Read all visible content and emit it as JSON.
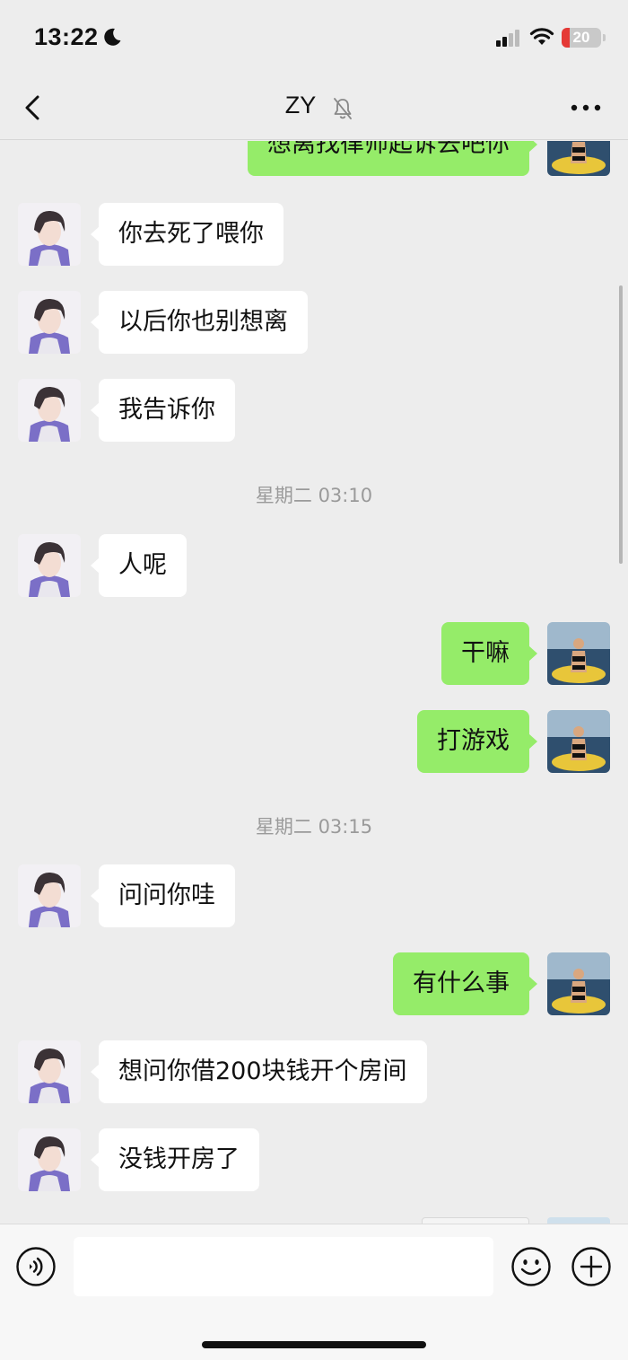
{
  "status_bar": {
    "time": "13:22",
    "battery_level": "20",
    "battery_fraction": 0.2,
    "icons": [
      "moon-icon",
      "signal-icon",
      "wifi-icon",
      "battery-icon"
    ]
  },
  "nav": {
    "title": "ZY",
    "icons": [
      "back-icon",
      "mute-bell-icon",
      "more-icon"
    ]
  },
  "messages": [
    {
      "side": "out",
      "text": "想离找律师起诉去吧你"
    },
    {
      "side": "in",
      "text": "你去死了喂你"
    },
    {
      "side": "in",
      "text": "以后你也别想离"
    },
    {
      "side": "in",
      "text": "我告诉你"
    },
    {
      "type": "time",
      "text": "星期二 03:10"
    },
    {
      "side": "in",
      "text": "人呢"
    },
    {
      "side": "out",
      "text": "干嘛"
    },
    {
      "side": "out",
      "text": "打游戏"
    },
    {
      "type": "time",
      "text": "星期二 03:15"
    },
    {
      "side": "in",
      "text": "问问你哇"
    },
    {
      "side": "out",
      "text": "有什么事"
    },
    {
      "side": "in",
      "text": "想问你借200块钱开个房间"
    },
    {
      "side": "in",
      "text": "没钱开房了"
    }
  ],
  "input_bar": {
    "placeholder": "",
    "icons": [
      "voice-icon",
      "emoji-icon",
      "plus-icon"
    ]
  },
  "colors": {
    "background": "#ededed",
    "outgoing_bubble": "#95ec69",
    "incoming_bubble": "#ffffff",
    "battery_low": "#e53935"
  }
}
